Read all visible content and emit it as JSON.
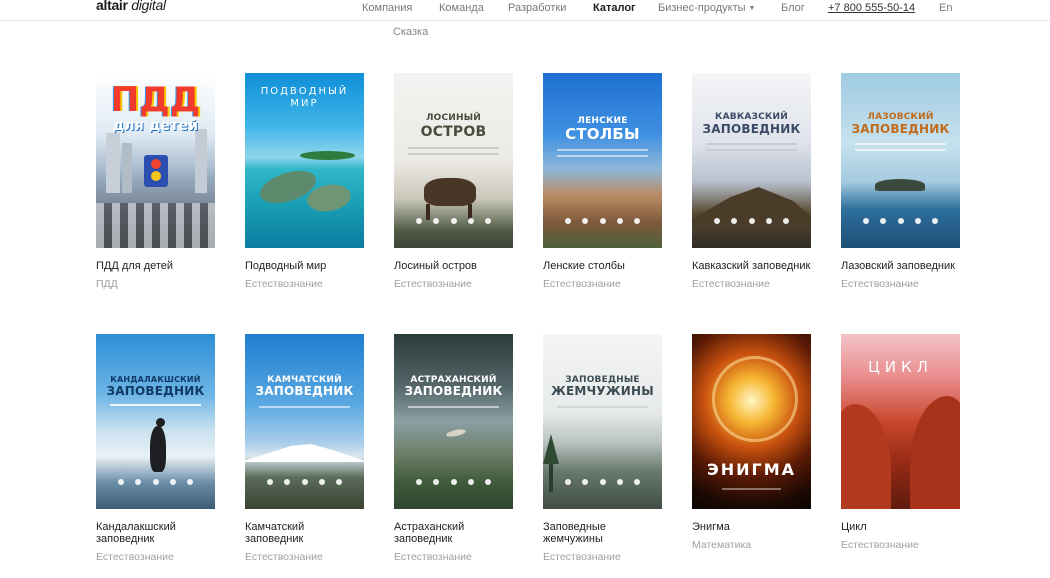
{
  "header": {
    "logo_brand": "altair",
    "logo_suffix": "digital",
    "nav": [
      {
        "label": "Компания"
      },
      {
        "label": "Команда"
      },
      {
        "label": "Разработки"
      },
      {
        "label": "Каталог"
      },
      {
        "label": "Бизнес-продукты"
      },
      {
        "label": "Блог"
      },
      {
        "label": "+7 800 555-50-14"
      },
      {
        "label": "En"
      }
    ]
  },
  "behind": {
    "category": "Сказка"
  },
  "cards": [
    {
      "title": "ПДД для детей",
      "category": "ПДД",
      "cover_text": "ПДД",
      "cover_sub": "для детей"
    },
    {
      "title": "Подводный мир",
      "category": "Естествознание",
      "cover_text": "ПОДВОДНЫЙ",
      "cover_sub": "МИР"
    },
    {
      "title": "Лосиный остров",
      "category": "Естествознание",
      "cover_text": "ЛОСИНЫЙ",
      "cover_sub": "ОСТРОВ"
    },
    {
      "title": "Ленские столбы",
      "category": "Естествознание",
      "cover_text": "ЛЕНСКИЕ",
      "cover_sub": "СТОЛБЫ"
    },
    {
      "title": "Кавказский заповедник",
      "category": "Естествознание",
      "cover_text": "КАВКАЗСКИЙ",
      "cover_sub": "ЗАПОВЕДНИК"
    },
    {
      "title": "Лазовский заповедник",
      "category": "Естествознание",
      "cover_text": "ЛАЗОВСКИЙ",
      "cover_sub": "ЗАПОВЕДНИК"
    },
    {
      "title": "Кандалакшский заповедник",
      "category": "Естествознание",
      "cover_text": "КАНДАЛАКШСКИЙ",
      "cover_sub": "ЗАПОВЕДНИК"
    },
    {
      "title": "Камчатский заповедник",
      "category": "Естествознание",
      "cover_text": "КАМЧАТСКИЙ",
      "cover_sub": "ЗАПОВЕДНИК"
    },
    {
      "title": "Астраханский заповедник",
      "category": "Естествознание",
      "cover_text": "АСТРАХАНСКИЙ",
      "cover_sub": "ЗАПОВЕДНИК"
    },
    {
      "title": "Заповедные жемчужины",
      "category": "Естествознание",
      "cover_text": "ЗАПОВЕДНЫЕ",
      "cover_sub": "ЖЕМЧУЖИНЫ"
    },
    {
      "title": "Энигма",
      "category": "Математика",
      "cover_text": "ЭНИГМА",
      "cover_sub": ""
    },
    {
      "title": "Цикл",
      "category": "Естествознание",
      "cover_text": "ЦИКЛ",
      "cover_sub": ""
    }
  ]
}
